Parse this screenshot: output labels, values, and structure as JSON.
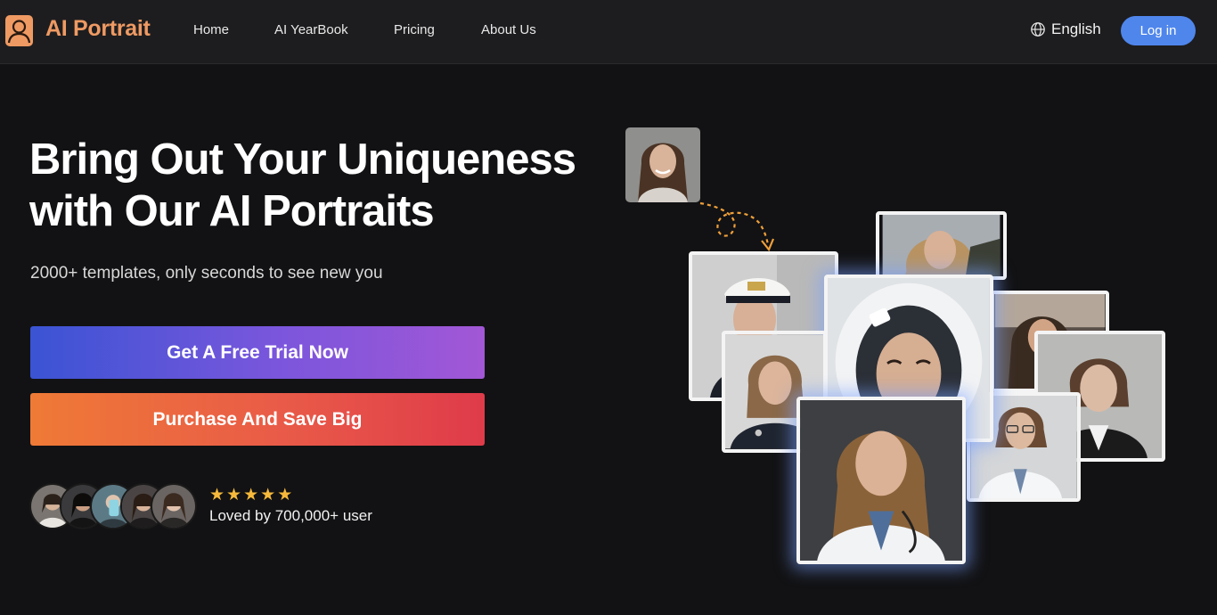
{
  "nav": {
    "brand": "AI Portrait",
    "links": [
      "Home",
      "AI YearBook",
      "Pricing",
      "About Us"
    ],
    "language": "English",
    "login_label": "Log in",
    "icons": {
      "logo": "person-icon",
      "language": "globe-icon"
    }
  },
  "hero": {
    "headline_line1": "Bring Out Your Uniqueness",
    "headline_line2": "with Our AI Portraits",
    "subtitle": "2000+ templates, only seconds to see new you",
    "trial_button": "Get A Free Trial Now",
    "purchase_button": "Purchase And Save Big",
    "social_proof": "Loved by 700,000+ user",
    "rating": 5,
    "avatar_count": 5
  },
  "colors": {
    "background": "#121214",
    "nav_background": "#1d1d1f",
    "brand": "#ef9a63",
    "login": "#4f86ec",
    "star": "#f6b93b",
    "trial_gradient": [
      "#3a54d4",
      "#a257d6"
    ],
    "purchase_gradient": [
      "#ef7a36",
      "#df3b4a"
    ]
  },
  "collage": {
    "source_photo": "casual-portrait",
    "portraits": [
      "sailor-captain-portrait",
      "outdoor-portrait",
      "astronaut-portrait",
      "police-portrait",
      "sunlit-portrait",
      "business-suit-portrait",
      "glasses-doctor-portrait",
      "doctor-portrait"
    ]
  }
}
